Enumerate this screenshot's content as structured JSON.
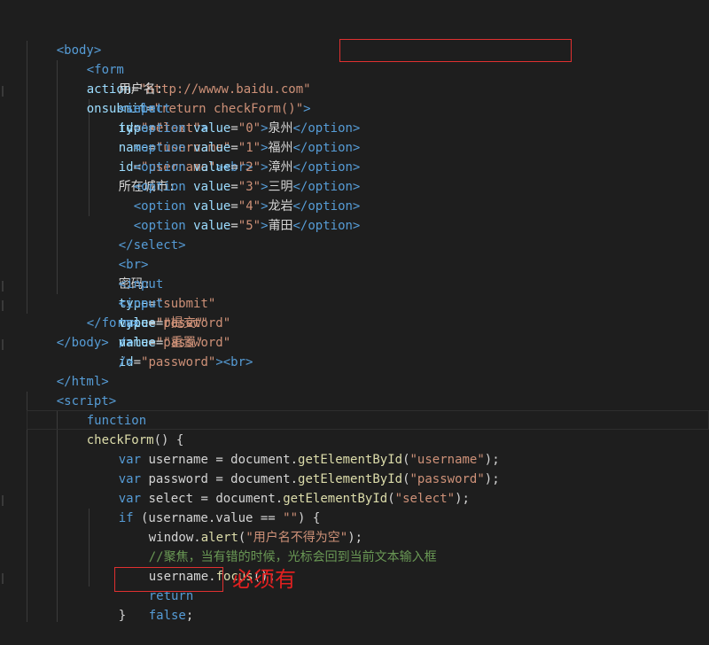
{
  "code": {
    "l_body": "<body>",
    "l_form_open": "<form",
    "l_form_action_attr": "action",
    "l_form_action_val": "\"http://wwww.baidu.com\"",
    "l_form_onsubmit_attr": "onsubmit",
    "l_form_onsubmit_val": "\"return checkForm()\"",
    "l_form_close_gt": ">",
    "l_user_label": "用户名:",
    "l_input": "<input",
    "l_type": "type",
    "l_type_text": "\"text\"",
    "l_name": "name",
    "l_username_str": "\"username\"",
    "l_id": "id",
    "l_br": "<br>",
    "l_city_label": "所在城市:",
    "l_select_open": "<select",
    "l_select_str": "\"select\"",
    "l_gt": ">",
    "options": [
      {
        "tag": "<option",
        "attr": "value",
        "val": "\"0\"",
        "text": "泉州",
        "end": "</option>"
      },
      {
        "tag": "<option",
        "attr": "value",
        "val": "\"1\"",
        "text": "福州",
        "end": "</option>"
      },
      {
        "tag": "<option",
        "attr": "value",
        "val": "\"2\"",
        "text": "漳州",
        "end": "</option>"
      },
      {
        "tag": "<option",
        "attr": "value",
        "val": "\"3\"",
        "text": "三明",
        "end": "</option>"
      },
      {
        "tag": "<option",
        "attr": "value",
        "val": "\"4\"",
        "text": "龙岩",
        "end": "</option>"
      },
      {
        "tag": "<option",
        "attr": "value",
        "val": "\"5\"",
        "text": "莆田",
        "end": "</option>"
      }
    ],
    "l_select_close": "</select>",
    "l_pwd_label": "密码:",
    "l_type_password": "\"password\"",
    "l_password_str": "\"password\"",
    "l_type_submit": "\"submit\"",
    "l_value": "value",
    "l_submit_val": "\"提交\"",
    "l_selfclose": "/>",
    "l_type_reset": "\"reset\"",
    "l_reset_val": "\"重置\"",
    "l_form_close": "</form>",
    "l_body_close": "</body>",
    "l_html_close": "</html>",
    "l_script": "<script>",
    "l_function": "function",
    "l_checkform": "checkForm",
    "l_fn_tail": "() {",
    "l_var": "var",
    "l_v_username": "username",
    "l_v_password": "password",
    "l_v_select": "select",
    "l_eq_doc": " = document.",
    "l_getbyid": "getElementById",
    "l_arg_username": "(\"username\");",
    "l_arg_password": "(\"password\");",
    "l_arg_select": "(\"select\");",
    "l_if": "if",
    "l_if_cond": " (username.value == \"\") {",
    "l_alert_obj": "window.",
    "l_alert": "alert",
    "l_alert_arg": "(\"用户名不得为空\");",
    "l_comment": "//聚焦，当有错的时候，光标会回到当前文本输入框",
    "l_focus_obj": "username.",
    "l_focus": "focus",
    "l_focus_tail": "();",
    "l_return": "return",
    "l_false": "false",
    "l_semicolon": ";",
    "l_brace_close": "}"
  },
  "annotation": {
    "note": "必须有"
  }
}
